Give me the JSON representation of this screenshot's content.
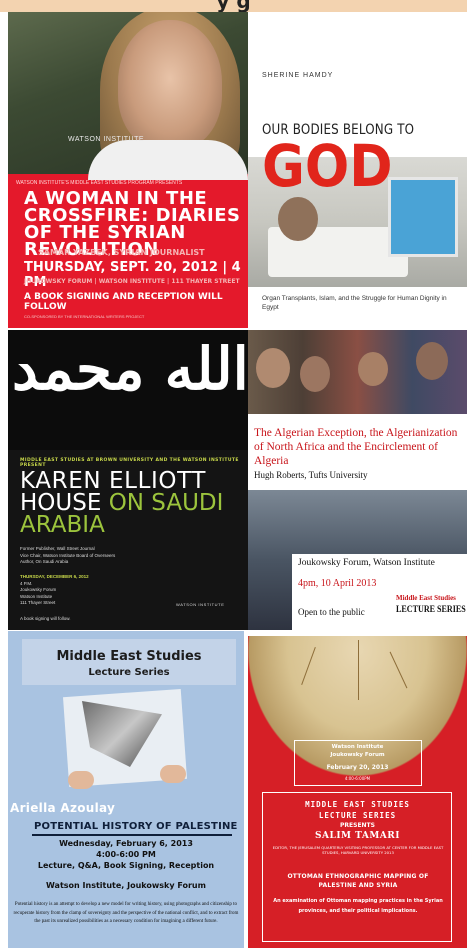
{
  "header": {
    "title": "y g"
  },
  "posters": [
    {
      "title": "A WOMAN IN THE CROSSFIRE: DIARIES OF THE SYRIAN REVOLUTION",
      "watson_label": "WATSON INSTITUTE",
      "sub_label": "WATSON INSTITUTE'S MIDDLE EAST STUDIES PROGRAM PRESENTS",
      "name": "SAMAR YAZBEK, SYRIAN JOURNALIST",
      "date_time": "THURSDAY, SEPT. 20, 2012 | 4 PM",
      "location": "JOUKOWSKY FORUM | WATSON INSTITUTE | 111 THAYER STREET",
      "follow": "A BOOK SIGNING AND RECEPTION WILL FOLLOW",
      "fine": "CO-SPONSORED BY THE INTERNATIONAL WRITERS PROJECT",
      "accent": "#e4192b"
    },
    {
      "author": "SHERINE HAMDY",
      "title_line1": "OUR BODIES BELONG TO",
      "title_line2": "GOD",
      "subtitle": "Organ Transplants, Islam, and the Struggle for Human Dignity in Egypt",
      "accent": "#e1251b"
    },
    {
      "calligraphy": "لا إله إلا الله محمد",
      "header": "MIDDLE EAST STUDIES AT BROWN UNIVERSITY AND THE WATSON INSTITUTE PRESENT",
      "name_line1": "KAREN ELLIOTT",
      "name_line2a": "HOUSE ",
      "name_line2b": "ON SAUDI",
      "name_line3": "ARABIA",
      "info": [
        "Former Publisher, Wall Street Journal",
        "Vice Chair, Watson Institute Board of Overseers",
        "Author, On Saudi Arabia"
      ],
      "date": "THURSDAY, DECEMBER 6, 2012",
      "when": [
        "4 P.M.",
        "Joukowsky Forum",
        "Watson Institute",
        "111 Thayer Street"
      ],
      "signing": "A book signing will follow.",
      "logo": "WATSON INSTITUTE"
    },
    {
      "title": "The Algerian Exception, the Algerianization of North Africa and the Encirclement of Algeria",
      "speaker": "Hugh Roberts, Tufts University",
      "venue": "Joukowsky Forum, Watson Institute",
      "time": "4pm, 10 April 2013",
      "open": "Open to the public",
      "series_top": "Middle East Studies",
      "series_bottom": "LECTURE SERIES",
      "accent": "#c8151b"
    },
    {
      "program": "Middle East Studies",
      "series": "Lecture Series",
      "author": "Ariella Azoulay",
      "title": "POTENTIAL HISTORY OF PALESTINE",
      "date": "Wednesday, February 6, 2013",
      "time": "4:00-6:00 PM",
      "events": "Lecture, Q&A, Book Signing, Reception",
      "venue": "Watson Institute, Joukowsky Forum",
      "description": "Potential history is an attempt to develop a new model for writing history, using photographs and citizenship to recuperate history from the clamp of sovereignty and the perspective of the national conflict, and to extract from the past its unrealized possibilities as a necessary condition for imagining a different future.",
      "background": "#a9c3e1"
    },
    {
      "institute": "Watson Institute",
      "forum": "Joukowsky Forum",
      "date": "February 20, 2013",
      "time": "4:00-6:00PM",
      "series_top": "MIDDLE EAST STUDIES",
      "series_bottom": "LECTURE SERIES",
      "presents": "PRESENTS",
      "speaker": "SALIM TAMARI",
      "bio": "EDITOR, THE JERUSALEM QUARTERLY VISITING PROFESSOR AT CENTER FOR MIDDLE EAST STUDIES, HARVARD UNIVERSITY 2013",
      "talk": "OTTOMAN ETHNOGRAPHIC MAPPING OF PALESTINE AND SYRIA",
      "examination": "An examination of Ottoman mapping practices in the Syrian provinces, and their political implications.",
      "background": "#d61f26"
    }
  ]
}
